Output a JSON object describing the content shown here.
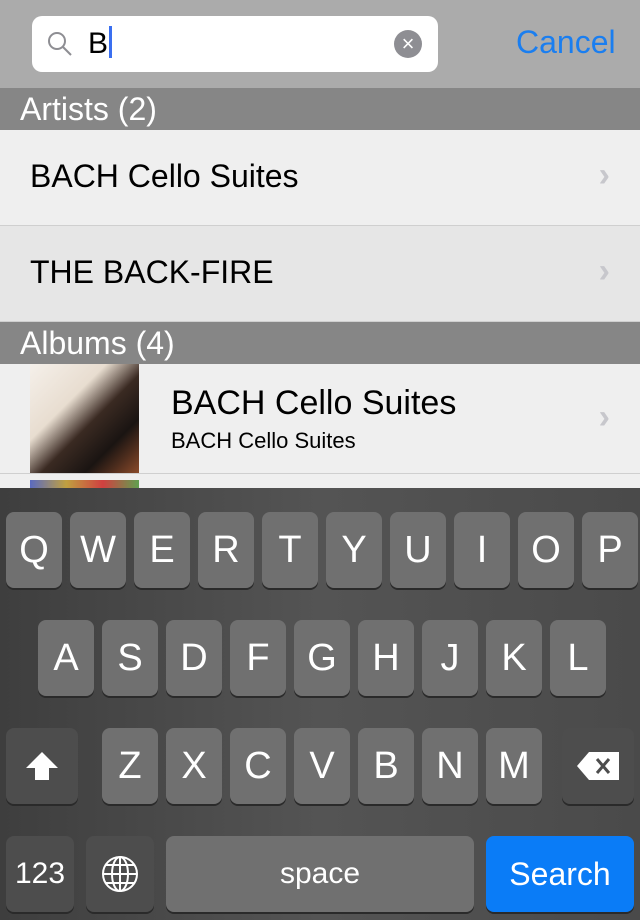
{
  "search": {
    "value": "B",
    "cancel_label": "Cancel"
  },
  "sections": [
    {
      "title": "Artists (2)",
      "items": [
        {
          "title": "BACH Cello Suites"
        },
        {
          "title": "THE BACK-FIRE"
        }
      ]
    },
    {
      "title": "Albums (4)",
      "items": [
        {
          "title": "BACH Cello Suites",
          "subtitle": "BACH Cello Suites"
        }
      ]
    }
  ],
  "keyboard": {
    "row1": [
      "Q",
      "W",
      "E",
      "R",
      "T",
      "Y",
      "U",
      "I",
      "O",
      "P"
    ],
    "row2": [
      "A",
      "S",
      "D",
      "F",
      "G",
      "H",
      "J",
      "K",
      "L"
    ],
    "row3": [
      "Z",
      "X",
      "C",
      "V",
      "B",
      "N",
      "M"
    ],
    "numbers_label": "123",
    "space_label": "space",
    "search_label": "Search"
  },
  "colors": {
    "accent": "#1a7ef0",
    "search_key": "#0a7cf7"
  }
}
